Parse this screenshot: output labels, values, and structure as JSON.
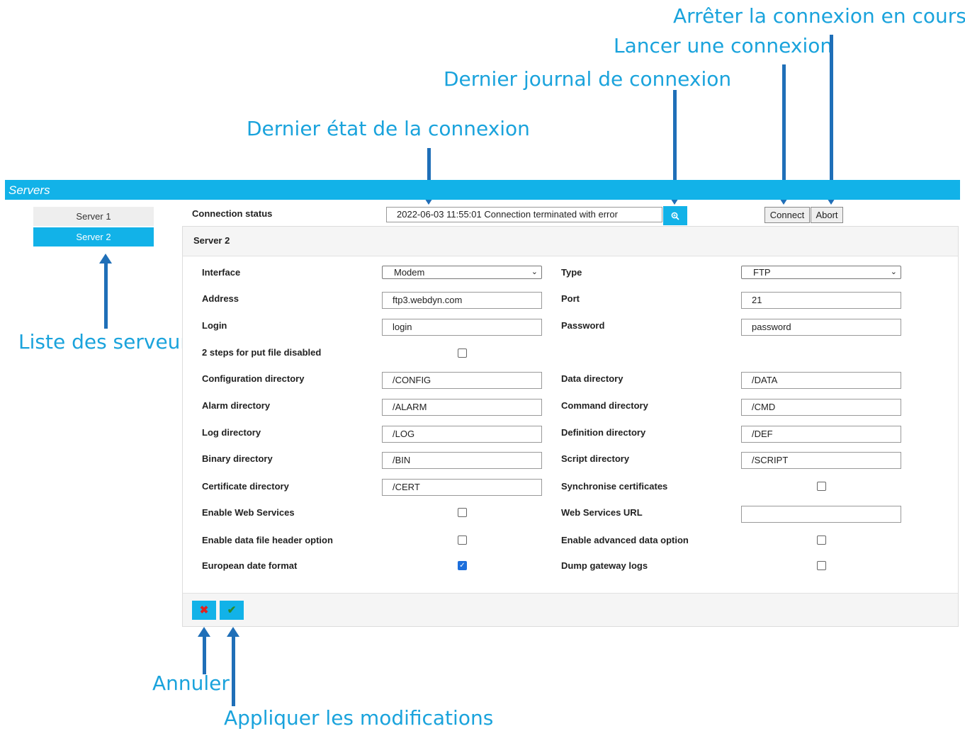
{
  "annotations": {
    "abort": "Arrêter la connexion en cours",
    "connect": "Lancer une connexion",
    "log": "Dernier journal de connexion",
    "status": "Dernier état de la connexion",
    "server_list": "Liste des serveurs",
    "cancel": "Annuler",
    "apply": "Appliquer les modifications"
  },
  "header": {
    "title": "Servers"
  },
  "servers": [
    "Server 1",
    "Server 2"
  ],
  "status": {
    "label": "Connection status",
    "value": "2022-06-03 11:55:01 Connection terminated with error",
    "zoom_icon": "zoom-icon",
    "connect_label": "Connect",
    "abort_label": "Abort"
  },
  "panel": {
    "title": "Server 2",
    "interface_label": "Interface",
    "interface_value": "Modem",
    "type_label": "Type",
    "type_value": "FTP",
    "address_label": "Address",
    "address_value": "ftp3.webdyn.com",
    "port_label": "Port",
    "port_value": "21",
    "login_label": "Login",
    "login_value": "login",
    "password_label": "Password",
    "password_value": "password",
    "two_steps_label": "2 steps for put file disabled",
    "config_dir_label": "Configuration directory",
    "config_dir_value": "/CONFIG",
    "data_dir_label": "Data directory",
    "data_dir_value": "/DATA",
    "alarm_dir_label": "Alarm directory",
    "alarm_dir_value": "/ALARM",
    "command_dir_label": "Command directory",
    "command_dir_value": "/CMD",
    "log_dir_label": "Log directory",
    "log_dir_value": "/LOG",
    "definition_dir_label": "Definition directory",
    "definition_dir_value": "/DEF",
    "binary_dir_label": "Binary directory",
    "binary_dir_value": "/BIN",
    "script_dir_label": "Script directory",
    "script_dir_value": "/SCRIPT",
    "cert_dir_label": "Certificate directory",
    "cert_dir_value": "/CERT",
    "sync_cert_label": "Synchronise certificates",
    "web_services_label": "Enable Web Services",
    "web_services_url_label": "Web Services URL",
    "web_services_url_value": "",
    "data_header_label": "Enable data file header option",
    "advanced_data_label": "Enable advanced data option",
    "eu_date_label": "European date format",
    "dump_logs_label": "Dump gateway logs"
  },
  "checkboxes": {
    "two_steps": false,
    "sync_cert": false,
    "web_services": false,
    "data_header": false,
    "advanced_data": false,
    "eu_date": true,
    "dump_logs": false
  },
  "footer": {
    "cancel_icon": "close-icon",
    "apply_icon": "check-icon"
  },
  "colors": {
    "accent": "#12b2e8",
    "annotation": "#1aa3dc",
    "arrow": "#1f6fb8",
    "cancel": "#e0211d",
    "apply": "#2a8a2a"
  }
}
